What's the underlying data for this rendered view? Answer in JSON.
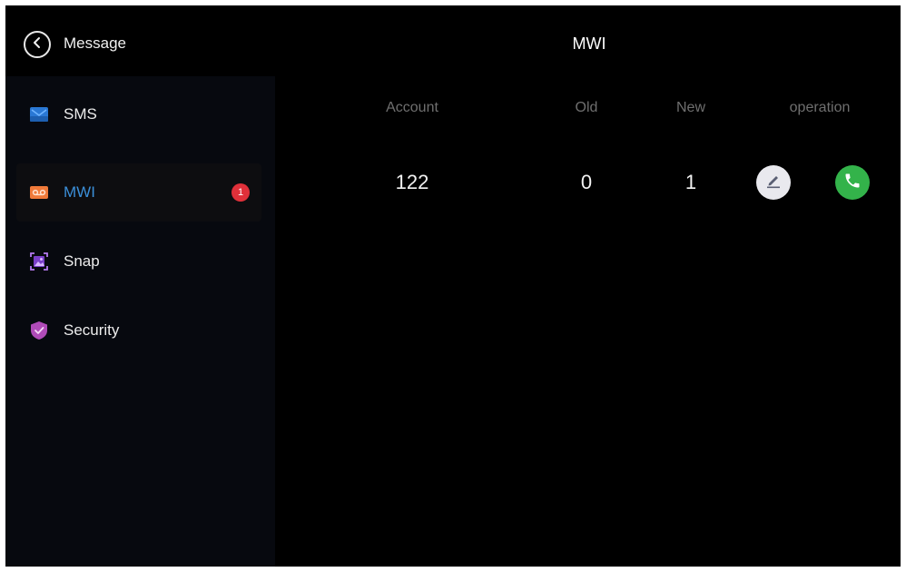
{
  "header": {
    "back_label": "Message",
    "title": "MWI"
  },
  "sidebar": {
    "items": [
      {
        "label": "SMS",
        "icon": "sms-icon",
        "active": false
      },
      {
        "label": "MWI",
        "icon": "voicemail-icon",
        "active": true,
        "badge": "1"
      },
      {
        "label": "Snap",
        "icon": "snapshot-icon",
        "active": false
      },
      {
        "label": "Security",
        "icon": "shield-icon",
        "active": false
      }
    ]
  },
  "table": {
    "columns": [
      "Account",
      "Old",
      "New",
      "operation"
    ],
    "rows": [
      {
        "account": "122",
        "old": "0",
        "new": "1"
      }
    ]
  },
  "colors": {
    "background": "#000000",
    "sidebar": "#07090f",
    "active_label": "#3b8fd9",
    "badge": "#e0303a",
    "call_button": "#33b34a",
    "edit_button": "#e9e9ee"
  }
}
